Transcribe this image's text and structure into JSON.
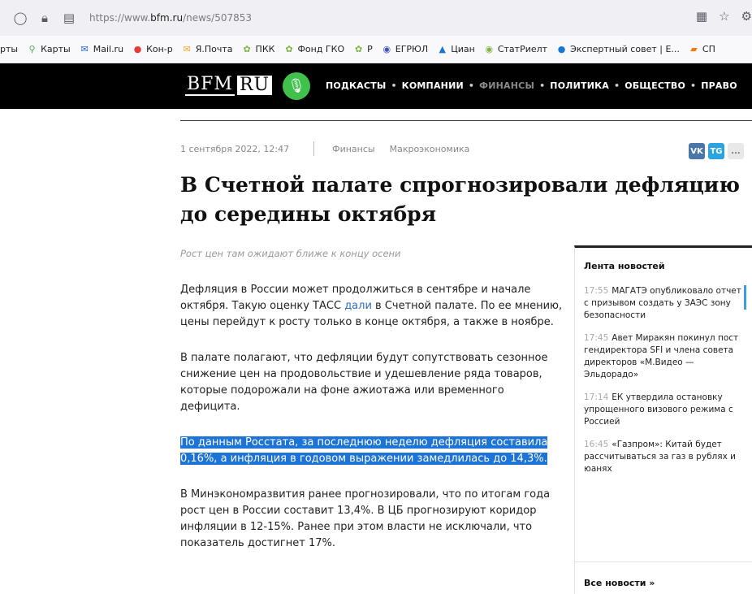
{
  "browser": {
    "url_prefix": "https://www.",
    "url_domain": "bfm.ru",
    "url_path": "/news/507853"
  },
  "bookmarks": [
    {
      "label": "рты",
      "icon": "none",
      "color": "#222"
    },
    {
      "label": "Карты",
      "icon": "map-pin-icon",
      "color": "#4caf50"
    },
    {
      "label": "Mail.ru",
      "icon": "mail-icon",
      "color": "#1565c0"
    },
    {
      "label": "Кон-р",
      "icon": "bookmark-icon",
      "color": "#e53935"
    },
    {
      "label": "Я.Почта",
      "icon": "envelope-icon",
      "color": "#f5a623"
    },
    {
      "label": "ПКК",
      "icon": "plant-icon",
      "color": "#7cb342"
    },
    {
      "label": "Фонд ГКО",
      "icon": "plant-icon",
      "color": "#7cb342"
    },
    {
      "label": "Р",
      "icon": "plant-icon",
      "color": "#7cb342"
    },
    {
      "label": "ЕГРЮЛ",
      "icon": "globe-icon",
      "color": "#3f51b5"
    },
    {
      "label": "Циан",
      "icon": "chart-icon",
      "color": "#1976d2"
    },
    {
      "label": "СтатРиелт",
      "icon": "globe-icon",
      "color": "#7cb342"
    },
    {
      "label": "Экспертный совет | Е...",
      "icon": "circle-icon",
      "color": "#1976d2"
    },
    {
      "label": "СП",
      "icon": "folder-icon",
      "color": "#f57c00"
    }
  ],
  "header": {
    "logo_left": "BFM",
    "logo_right": "RU",
    "menu": [
      "ПОДКАСТЫ",
      "КОМПАНИИ",
      "ФИНАНСЫ",
      "ПОЛИТИКА",
      "ОБЩЕСТВО",
      "ПРАВО"
    ],
    "active_menu": "ФИНАНСЫ"
  },
  "article": {
    "date": "1 сентября 2022, 12:47",
    "tags": [
      "Финансы",
      "Макроэкономика"
    ],
    "share": [
      "VK",
      "TG",
      "..."
    ],
    "title": "В Счетной палате спрогнозировали дефляцию до середины октября",
    "lead": "Рост цен там ожидают ближе к концу осени",
    "p1_before": "Дефляция в России может продолжиться в сентябре и начале октября. Такую оценку ТАСС ",
    "p1_link": "дали",
    "p1_after": " в Счетной палате. По ее мнению, цены перейдут к росту только в конце октября, а также в ноябре.",
    "p2": "В палате полагают, что дефляции будут сопутствовать сезонное снижение цен на продовольствие и удешевление ряда товаров, которые подорожали на фоне ажиотажа или временного дефицита.",
    "p3": "По данным Росстата, за последнюю неделю дефляция составила 0,16%, а инфляция в годовом выражении замедлилась до 14,3%.",
    "p4": "В Минэкономразвития ранее прогнозировали, что по итогам года рост цен в России составит 13,4%. В ЦБ прогнозируют коридор инфляции в 12-15%. Ранее при этом власти не исключали, что показатель достигнет 17%."
  },
  "sidebar": {
    "title": "Лента новостей",
    "items": [
      {
        "time": "17:55",
        "text": "МАГАТЭ опубликовало отчет с призывом создать у ЗАЭС зону безопасности"
      },
      {
        "time": "17:45",
        "text": "Авет Миракян покинул пост гендиректора SFI и члена совета директоров «М.Видео — Эльдорадо»"
      },
      {
        "time": "17:14",
        "text": "ЕК утвердила остановку упрощенного визового режима с Россией"
      },
      {
        "time": "16:45",
        "text": "«Газпром»: Китай будет рассчитываться за газ в рублях и юанях"
      }
    ],
    "all_news": "Все новости »"
  }
}
